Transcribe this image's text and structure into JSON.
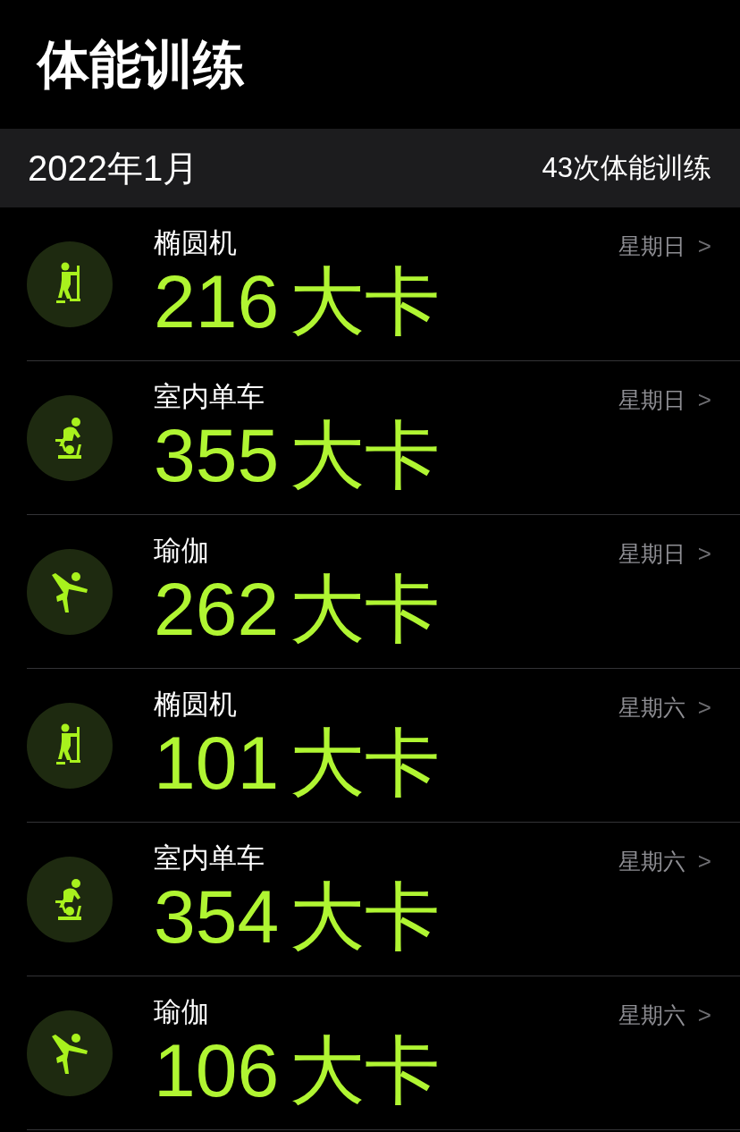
{
  "title": "体能训练",
  "section": {
    "month": "2022年1月",
    "count": "43次体能训练"
  },
  "workouts": [
    {
      "kind": "elliptical",
      "name": "椭圆机",
      "calories": "216",
      "unit": "大卡",
      "day": "星期日",
      "chevron": ">"
    },
    {
      "kind": "cycling",
      "name": "室内单车",
      "calories": "355",
      "unit": "大卡",
      "day": "星期日",
      "chevron": ">"
    },
    {
      "kind": "yoga",
      "name": "瑜伽",
      "calories": "262",
      "unit": "大卡",
      "day": "星期日",
      "chevron": ">"
    },
    {
      "kind": "elliptical",
      "name": "椭圆机",
      "calories": "101",
      "unit": "大卡",
      "day": "星期六",
      "chevron": ">"
    },
    {
      "kind": "cycling",
      "name": "室内单车",
      "calories": "354",
      "unit": "大卡",
      "day": "星期六",
      "chevron": ">"
    },
    {
      "kind": "yoga",
      "name": "瑜伽",
      "calories": "106",
      "unit": "大卡",
      "day": "星期六",
      "chevron": ">"
    }
  ]
}
